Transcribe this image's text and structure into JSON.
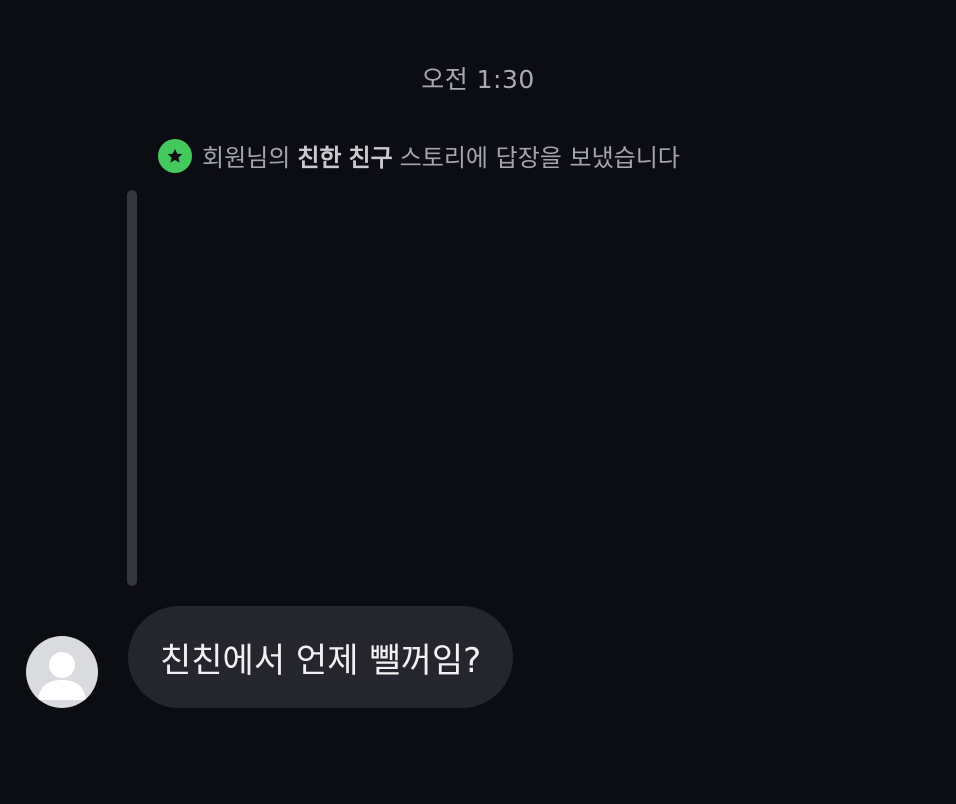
{
  "conversation": {
    "timestamp": "오전 1:30",
    "story_reply_notice": {
      "prefix": "회원님의",
      "highlight_1": "친한",
      "highlight_2": "친구",
      "suffix": "스토리에 답장을 보냈습니다",
      "icon": "star-icon",
      "badge_color": "#43c95c"
    },
    "messages": [
      {
        "sender": "other",
        "avatar_icon": "default-user-icon",
        "text": "친친에서 언제 뺄꺼임?"
      }
    ]
  }
}
